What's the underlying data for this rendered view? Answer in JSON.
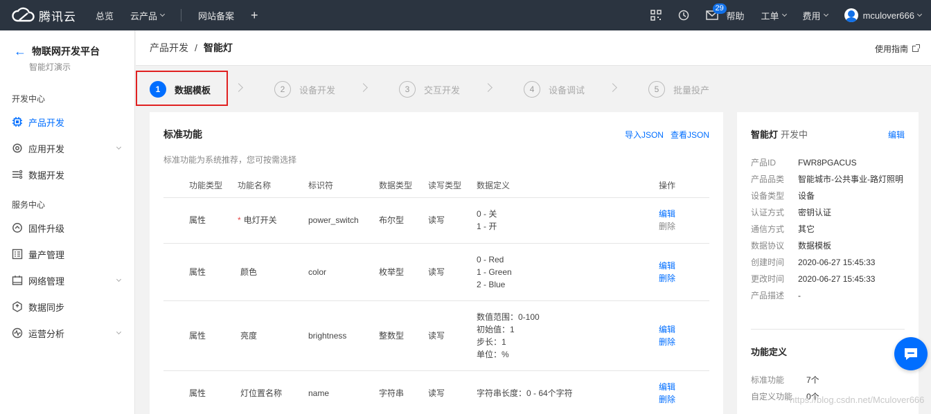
{
  "topbar": {
    "brand": "腾讯云",
    "nav": [
      "总览",
      "云产品",
      "网站备案"
    ],
    "plus": "+",
    "badge": "29",
    "help": "帮助",
    "ticket": "工单",
    "billing": "费用",
    "user": "mculover666"
  },
  "sidebar": {
    "title": "物联网开发平台",
    "subtitle": "智能灯演示",
    "groups": [
      {
        "label": "开发中心",
        "items": [
          {
            "label": "产品开发",
            "icon": "chip-icon",
            "active": true
          },
          {
            "label": "应用开发",
            "icon": "gear-icon",
            "expand": true
          },
          {
            "label": "数据开发",
            "icon": "flow-icon"
          }
        ]
      },
      {
        "label": "服务中心",
        "items": [
          {
            "label": "固件升级",
            "icon": "upgrade-icon"
          },
          {
            "label": "量产管理",
            "icon": "list-icon"
          },
          {
            "label": "网络管理",
            "icon": "network-icon",
            "expand": true
          },
          {
            "label": "数据同步",
            "icon": "sync-icon"
          },
          {
            "label": "运营分析",
            "icon": "pulse-icon",
            "expand": true
          }
        ]
      }
    ]
  },
  "breadcrumb": {
    "parent": "产品开发",
    "sep": "/",
    "current": "智能灯",
    "guide": "使用指南"
  },
  "steps": [
    {
      "num": "1",
      "label": "数据模板",
      "active": true
    },
    {
      "num": "2",
      "label": "设备开发"
    },
    {
      "num": "3",
      "label": "交互开发"
    },
    {
      "num": "4",
      "label": "设备调试"
    },
    {
      "num": "5",
      "label": "批量投产"
    }
  ],
  "card": {
    "title": "标准功能",
    "import_json": "导入JSON",
    "view_json": "查看JSON",
    "desc": "标准功能为系统推荐，您可按需选择",
    "columns": [
      "功能类型",
      "功能名称",
      "标识符",
      "数据类型",
      "读写类型",
      "数据定义",
      "操作"
    ],
    "rows": [
      {
        "type": "属性",
        "required": "*",
        "name": "电灯开关",
        "id": "power_switch",
        "dtype": "布尔型",
        "rw": "读写",
        "def": [
          "0 - 关",
          "1 - 开"
        ],
        "edit": "编辑",
        "del": "删除",
        "delBlue": false
      },
      {
        "type": "属性",
        "required": "",
        "name": "颜色",
        "id": "color",
        "dtype": "枚举型",
        "rw": "读写",
        "def": [
          "0 - Red",
          "1 - Green",
          "2 - Blue"
        ],
        "edit": "编辑",
        "del": "删除",
        "delBlue": true
      },
      {
        "type": "属性",
        "required": "",
        "name": "亮度",
        "id": "brightness",
        "dtype": "整数型",
        "rw": "读写",
        "def": [
          "数值范围：0-100",
          "初始值：1",
          "步长：1",
          "单位：%"
        ],
        "edit": "编辑",
        "del": "删除",
        "delBlue": true
      },
      {
        "type": "属性",
        "required": "",
        "name": "灯位置名称",
        "id": "name",
        "dtype": "字符串",
        "rw": "读写",
        "def": [
          "字符串长度：0 - 64个字符"
        ],
        "edit": "编辑",
        "del": "删除",
        "delBlue": true
      }
    ]
  },
  "panel": {
    "name": "智能灯",
    "status": "开发中",
    "edit": "编辑",
    "info": [
      {
        "k": "产品ID",
        "v": "FWR8PGACUS"
      },
      {
        "k": "产品品类",
        "v": "智能城市-公共事业-路灯照明"
      },
      {
        "k": "设备类型",
        "v": "设备"
      },
      {
        "k": "认证方式",
        "v": "密钥认证"
      },
      {
        "k": "通信方式",
        "v": "其它"
      },
      {
        "k": "数据协议",
        "v": "数据模板"
      },
      {
        "k": "创建时间",
        "v": "2020-06-27 15:45:33"
      },
      {
        "k": "更改时间",
        "v": "2020-06-27 15:45:33"
      },
      {
        "k": "产品描述",
        "v": "-"
      }
    ],
    "func_title": "功能定义",
    "func": [
      {
        "k": "标准功能",
        "v": "7个"
      },
      {
        "k": "自定义功能",
        "v": "0个"
      }
    ]
  },
  "watermark": "https://blog.csdn.net/Mculover666"
}
